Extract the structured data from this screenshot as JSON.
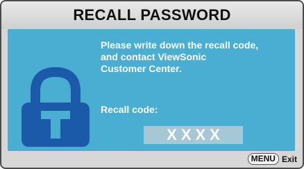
{
  "dialog": {
    "title": "RECALL PASSWORD",
    "message": "Please write down the recall code,\nand contact ViewSonic\nCustomer Center.",
    "recall_label": "Recall code:",
    "recall_code": "XXXX",
    "icon": "lock-icon"
  },
  "footer": {
    "menu_key": "MENU",
    "exit_label": "Exit"
  },
  "colors": {
    "panel": "#4aaed3",
    "lock": "#1a5aa8",
    "code_box": "#a6c7d6"
  }
}
